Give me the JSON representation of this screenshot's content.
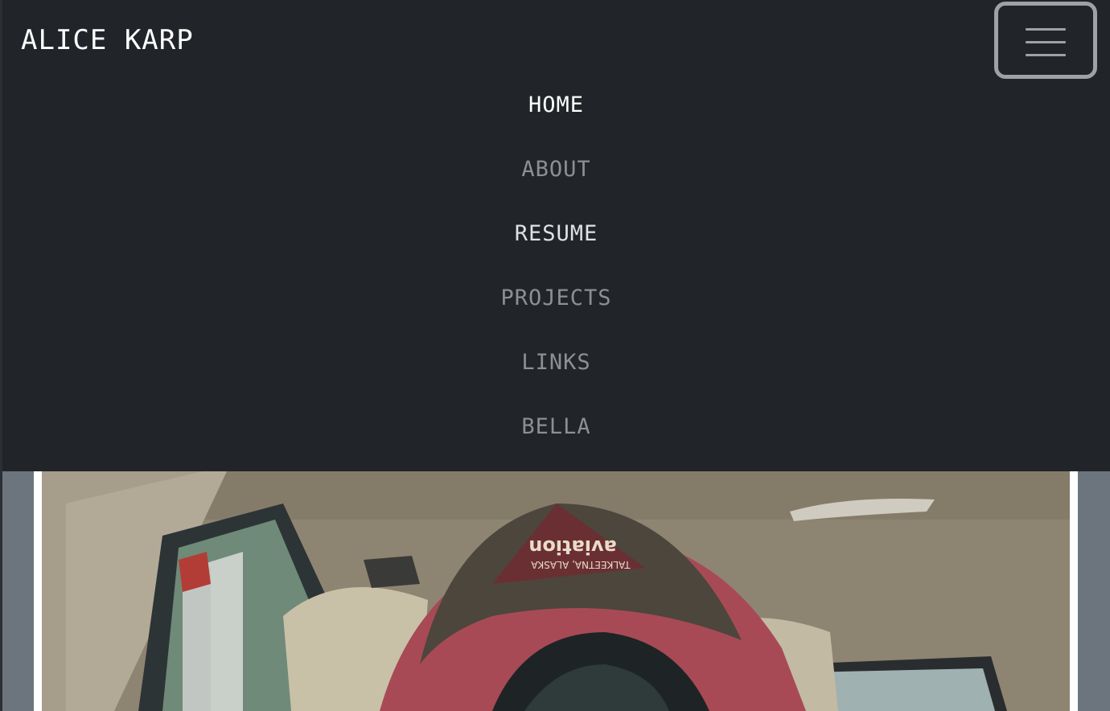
{
  "brand": "ALICE KARP",
  "toggler": {
    "icon": "hamburger-menu-icon"
  },
  "nav": {
    "items": [
      {
        "label": "HOME",
        "state": "active"
      },
      {
        "label": "ABOUT",
        "state": "default"
      },
      {
        "label": "RESUME",
        "state": "bright"
      },
      {
        "label": "PROJECTS",
        "state": "default"
      },
      {
        "label": "LINKS",
        "state": "default"
      },
      {
        "label": "BELLA",
        "state": "default"
      }
    ]
  },
  "photo": {
    "hat_text_line1": "aviation",
    "hat_text_line2": "TALKEETNA, ALASKA"
  },
  "colors": {
    "navbar_bg": "#212529",
    "page_bg": "#6c757d",
    "link_active": "#ffffff",
    "link_muted": "#8c9094"
  }
}
